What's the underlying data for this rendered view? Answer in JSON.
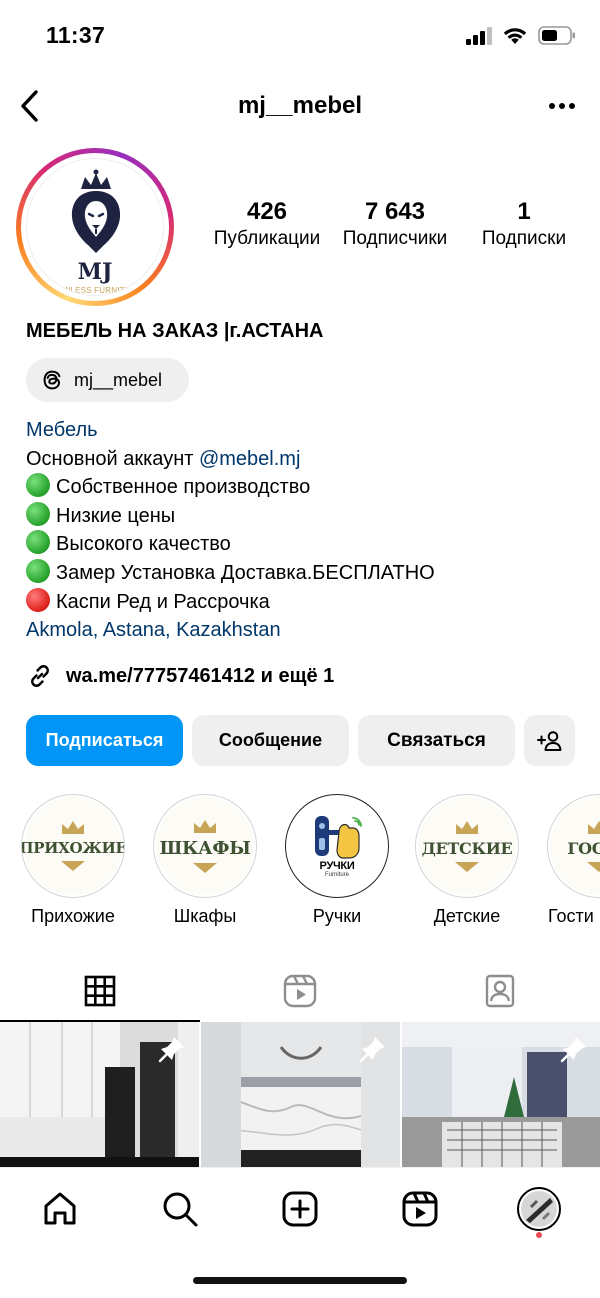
{
  "status_bar": {
    "time": "11:37"
  },
  "header": {
    "username": "mj__mebel"
  },
  "profile": {
    "avatar_brand": "MJ",
    "avatar_subtitle": "FLAWLESS FURNITURE",
    "stats": [
      {
        "value": "426",
        "label": "Публикации"
      },
      {
        "value": "7 643",
        "label": "Подписчики"
      },
      {
        "value": "1",
        "label": "Подписки"
      }
    ],
    "name": "МЕБЕЛЬ НА ЗАКАЗ |г.АСТАНА",
    "threads_handle": "mj__mebel",
    "category": "Мебель",
    "bio_lines": {
      "main_prefix": "Основной аккаунт ",
      "main_mention": "@mebel.mj",
      "l1": "Собственное производство",
      "l2": "Низкие цены",
      "l3": "Высокого качество",
      "l4": "Замер Установка Доставка.БЕСПЛАТНО",
      "l5": "Каспи Ред и Рассрочка"
    },
    "location": "Akmola, Astana, Kazakhstan",
    "link": "wa.me/77757461412 и ещё 1"
  },
  "actions": {
    "follow": "Подписаться",
    "message": "Сообщение",
    "contact": "Связаться"
  },
  "highlights": [
    {
      "word": "ПРИХОЖИЕ",
      "label": "Прихожие"
    },
    {
      "word": "ШКАФЫ",
      "label": "Шкафы"
    },
    {
      "word": "РУЧКИ",
      "sub": "Furniture",
      "label": "Ручки"
    },
    {
      "word": "ДЕТСКИЕ",
      "label": "Детские"
    },
    {
      "word": "ГОСТИ",
      "label": "Гости"
    }
  ],
  "colors": {
    "accent": "#0095f6",
    "link": "#00376b",
    "button_bg": "#efefef",
    "notification_dot": "#ed4956"
  },
  "tabs": [
    "grid-icon",
    "reels-icon",
    "tagged-icon"
  ],
  "grid_posts": [
    "post-1-pinned",
    "post-2-pinned",
    "post-3-pinned"
  ],
  "bottom_nav": [
    "home-icon",
    "search-icon",
    "create-icon",
    "reels-icon",
    "profile-avatar"
  ]
}
